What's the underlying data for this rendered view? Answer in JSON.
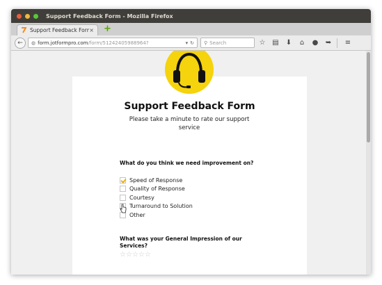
{
  "window": {
    "title": "Support Feedback Form - Mozilla Firefox"
  },
  "tab": {
    "label": "Support Feedback Form",
    "close": "×",
    "new_tab": "+"
  },
  "nav": {
    "url_host": "form.jotformpro.com",
    "url_path": "/form/51242405988964?",
    "search_placeholder": "Search",
    "icons": [
      "back-icon",
      "bookmark-star-icon",
      "reader-icon",
      "download-icon",
      "home-icon",
      "chat-icon",
      "send-icon",
      "menu-icon"
    ]
  },
  "form": {
    "title": "Support Feedback Form",
    "subtitle": "Please take a minute to rate our support service",
    "q1": {
      "label": "What do you think we need improvement on?",
      "options": [
        {
          "label": "Speed of Response",
          "checked": true
        },
        {
          "label": "Quality of Response",
          "checked": false
        },
        {
          "label": "Courtesy",
          "checked": false
        },
        {
          "label": "Turnaround to Solution",
          "checked": false
        },
        {
          "label": "Other",
          "checked": false
        }
      ]
    },
    "q2": {
      "label": "What was your General Impression of our Services?",
      "stars": [
        "☆",
        "☆",
        "☆",
        "☆",
        "☆"
      ],
      "rating": 0
    }
  },
  "colors": {
    "logo_yellow": "#f5d30d",
    "check_yellow": "#e8b400",
    "titlebar": "#403e3a",
    "new_tab_green": "#58a500"
  }
}
